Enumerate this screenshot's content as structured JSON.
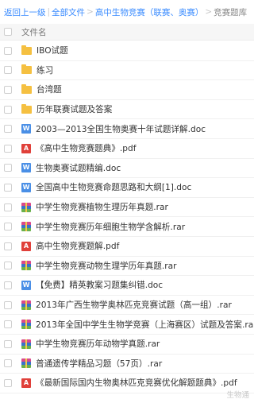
{
  "breadcrumb": {
    "back": "返回上一级",
    "sep1": "|",
    "all_files": "全部文件",
    "sep2": ">",
    "parent": "高中生物竞赛（联赛、奥赛）",
    "sep3": ">",
    "current": "竞赛题库"
  },
  "header": {
    "column_name": "文件名"
  },
  "files": [
    {
      "type": "folder",
      "icon": "folder-icon",
      "name": "IBO试题"
    },
    {
      "type": "folder",
      "icon": "folder-icon",
      "name": "练习"
    },
    {
      "type": "folder",
      "icon": "folder-icon",
      "name": "台湾题"
    },
    {
      "type": "folder",
      "icon": "folder-icon",
      "name": "历年联赛试题及答案"
    },
    {
      "type": "doc",
      "icon": "word-doc-icon",
      "glyph": "W",
      "name": "2003—2013全国生物奥赛十年试题详解.doc"
    },
    {
      "type": "pdf",
      "icon": "pdf-icon",
      "glyph": "A",
      "name": "《高中生物竞赛题典》.pdf"
    },
    {
      "type": "doc",
      "icon": "word-doc-icon",
      "glyph": "W",
      "name": "生物奥赛试题精编.doc"
    },
    {
      "type": "doc",
      "icon": "word-doc-icon",
      "glyph": "W",
      "name": "全国高中生物竞赛命题思路和大纲[1].doc"
    },
    {
      "type": "rar",
      "icon": "rar-archive-icon",
      "name": "中学生物竞赛植物生理历年真题.rar"
    },
    {
      "type": "rar",
      "icon": "rar-archive-icon",
      "name": "中学生物竞赛历年细胞生物学含解析.rar"
    },
    {
      "type": "pdf",
      "icon": "pdf-icon",
      "glyph": "A",
      "name": "高中生物竞赛题解.pdf"
    },
    {
      "type": "rar",
      "icon": "rar-archive-icon",
      "name": "中学生物竞赛动物生理学历年真题.rar"
    },
    {
      "type": "doc",
      "icon": "word-doc-icon",
      "glyph": "W",
      "name": "【免费】精英教案习题集纠错.doc"
    },
    {
      "type": "rar",
      "icon": "rar-archive-icon",
      "name": "2013年广西生物学奥林匹克竞赛试题（高一组）.rar"
    },
    {
      "type": "rar",
      "icon": "rar-archive-icon",
      "name": "2013年全国中学生生物学竞赛（上海赛区）试题及答案.rar"
    },
    {
      "type": "rar",
      "icon": "rar-archive-icon",
      "name": "中学生物竞赛历年动物学真题.rar"
    },
    {
      "type": "rar",
      "icon": "rar-archive-icon",
      "name": "普通遗传学精品习题（57页）.rar"
    },
    {
      "type": "pdf",
      "icon": "pdf-icon",
      "glyph": "A",
      "name": "《最新国际国内生物奥林匹克竞赛优化解题题典》.pdf"
    }
  ],
  "watermark": "生物通",
  "colors": {
    "link": "#3b8cff",
    "folder": "#f5c041",
    "doc": "#4a8fe6",
    "pdf": "#e0403a"
  }
}
